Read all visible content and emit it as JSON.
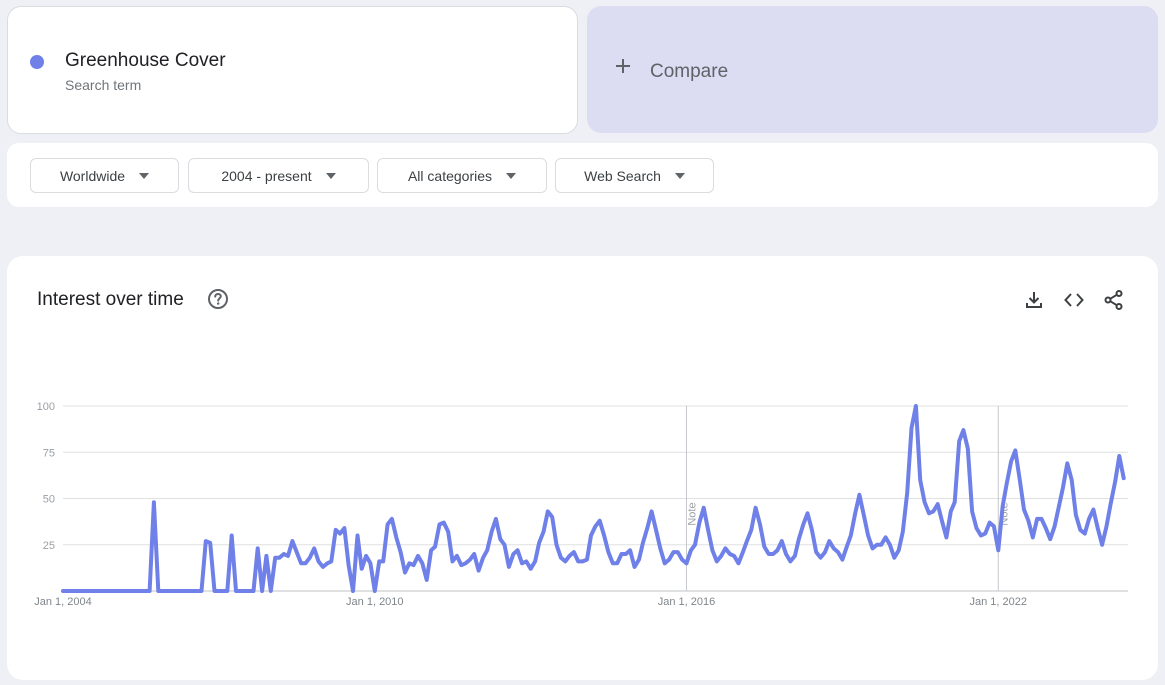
{
  "search_term": {
    "name": "Greenhouse Cover",
    "type": "Search term",
    "color": "#6f80e8"
  },
  "compare": {
    "label": "Compare",
    "icon": "plus-icon"
  },
  "filters": [
    {
      "label": "Worldwide"
    },
    {
      "label": "2004 - present"
    },
    {
      "label": "All categories"
    },
    {
      "label": "Web Search"
    }
  ],
  "panel": {
    "title": "Interest over time",
    "help_icon": "help-circle-icon",
    "tools": [
      "download-icon",
      "embed-code-icon",
      "share-icon"
    ]
  },
  "chart_data": {
    "type": "line",
    "title": "",
    "xlabel": "",
    "ylabel": "",
    "xlim": [
      "Jan 1, 2004",
      "Jun 2024"
    ],
    "ylim": [
      0,
      100
    ],
    "y_ticks": [
      100,
      75,
      50,
      25
    ],
    "x_tick_labels": [
      "Jan 1, 2004",
      "Jan 1, 2010",
      "Jan 1, 2016",
      "Jan 1, 2022"
    ],
    "grid": true,
    "legend": "none",
    "annotations": [
      {
        "label": "Note",
        "at": "Jan 1, 2016"
      },
      {
        "label": "Note",
        "at": "Jan 1, 2022"
      }
    ],
    "series": [
      {
        "color": "#6f80e8",
        "points": [
          [
            "2004-01",
            0
          ],
          [
            "2005-09",
            0
          ],
          [
            "2005-10",
            48
          ],
          [
            "2005-11",
            0
          ],
          [
            "2006-09",
            0
          ],
          [
            "2006-10",
            27
          ],
          [
            "2006-11",
            26
          ],
          [
            "2006-12",
            0
          ],
          [
            "2007-03",
            0
          ],
          [
            "2007-04",
            30
          ],
          [
            "2007-05",
            0
          ],
          [
            "2007-09",
            0
          ],
          [
            "2007-10",
            23
          ],
          [
            "2007-11",
            0
          ],
          [
            "2007-12",
            19
          ],
          [
            "2008-01",
            0
          ],
          [
            "2008-02",
            18
          ],
          [
            "2008-03",
            18
          ],
          [
            "2008-04",
            20
          ],
          [
            "2008-05",
            19
          ],
          [
            "2008-06",
            27
          ],
          [
            "2008-07",
            21
          ],
          [
            "2008-08",
            15
          ],
          [
            "2008-09",
            15
          ],
          [
            "2008-10",
            18
          ],
          [
            "2008-11",
            23
          ],
          [
            "2008-12",
            16
          ],
          [
            "2009-01",
            13
          ],
          [
            "2009-02",
            15
          ],
          [
            "2009-03",
            16
          ],
          [
            "2009-04",
            33
          ],
          [
            "2009-05",
            31
          ],
          [
            "2009-06",
            34
          ],
          [
            "2009-07",
            14
          ],
          [
            "2009-08",
            0
          ],
          [
            "2009-09",
            30
          ],
          [
            "2009-10",
            12
          ],
          [
            "2009-11",
            19
          ],
          [
            "2009-12",
            15
          ],
          [
            "2010-01",
            0
          ],
          [
            "2010-02",
            16
          ],
          [
            "2010-03",
            16
          ],
          [
            "2010-04",
            36
          ],
          [
            "2010-05",
            39
          ],
          [
            "2010-06",
            29
          ],
          [
            "2010-07",
            21
          ],
          [
            "2010-08",
            10
          ],
          [
            "2010-09",
            15
          ],
          [
            "2010-10",
            14
          ],
          [
            "2010-11",
            19
          ],
          [
            "2010-12",
            15
          ],
          [
            "2011-01",
            6
          ],
          [
            "2011-02",
            22
          ],
          [
            "2011-03",
            24
          ],
          [
            "2011-04",
            36
          ],
          [
            "2011-05",
            37
          ],
          [
            "2011-06",
            32
          ],
          [
            "2011-07",
            16
          ],
          [
            "2011-08",
            19
          ],
          [
            "2011-09",
            14
          ],
          [
            "2011-10",
            15
          ],
          [
            "2011-11",
            17
          ],
          [
            "2011-12",
            20
          ],
          [
            "2012-01",
            11
          ],
          [
            "2012-02",
            18
          ],
          [
            "2012-03",
            22
          ],
          [
            "2012-04",
            32
          ],
          [
            "2012-05",
            39
          ],
          [
            "2012-06",
            28
          ],
          [
            "2012-07",
            25
          ],
          [
            "2012-08",
            13
          ],
          [
            "2012-09",
            20
          ],
          [
            "2012-10",
            22
          ],
          [
            "2012-11",
            15
          ],
          [
            "2012-12",
            16
          ],
          [
            "2013-01",
            12
          ],
          [
            "2013-02",
            16
          ],
          [
            "2013-03",
            26
          ],
          [
            "2013-04",
            32
          ],
          [
            "2013-05",
            43
          ],
          [
            "2013-06",
            40
          ],
          [
            "2013-07",
            25
          ],
          [
            "2013-08",
            18
          ],
          [
            "2013-09",
            16
          ],
          [
            "2013-10",
            19
          ],
          [
            "2013-11",
            21
          ],
          [
            "2013-12",
            16
          ],
          [
            "2014-01",
            16
          ],
          [
            "2014-02",
            17
          ],
          [
            "2014-03",
            30
          ],
          [
            "2014-04",
            35
          ],
          [
            "2014-05",
            38
          ],
          [
            "2014-06",
            30
          ],
          [
            "2014-07",
            21
          ],
          [
            "2014-08",
            15
          ],
          [
            "2014-09",
            15
          ],
          [
            "2014-10",
            20
          ],
          [
            "2014-11",
            20
          ],
          [
            "2014-12",
            22
          ],
          [
            "2015-01",
            13
          ],
          [
            "2015-02",
            17
          ],
          [
            "2015-03",
            26
          ],
          [
            "2015-04",
            34
          ],
          [
            "2015-05",
            43
          ],
          [
            "2015-06",
            33
          ],
          [
            "2015-07",
            23
          ],
          [
            "2015-08",
            15
          ],
          [
            "2015-09",
            17
          ],
          [
            "2015-10",
            21
          ],
          [
            "2015-11",
            21
          ],
          [
            "2015-12",
            17
          ],
          [
            "2016-01",
            15
          ],
          [
            "2016-02",
            22
          ],
          [
            "2016-03",
            25
          ],
          [
            "2016-04",
            37
          ],
          [
            "2016-05",
            45
          ],
          [
            "2016-06",
            33
          ],
          [
            "2016-07",
            22
          ],
          [
            "2016-08",
            16
          ],
          [
            "2016-09",
            19
          ],
          [
            "2016-10",
            23
          ],
          [
            "2016-11",
            20
          ],
          [
            "2016-12",
            19
          ],
          [
            "2017-01",
            15
          ],
          [
            "2017-02",
            21
          ],
          [
            "2017-03",
            27
          ],
          [
            "2017-04",
            33
          ],
          [
            "2017-05",
            45
          ],
          [
            "2017-06",
            36
          ],
          [
            "2017-07",
            24
          ],
          [
            "2017-08",
            20
          ],
          [
            "2017-09",
            20
          ],
          [
            "2017-10",
            22
          ],
          [
            "2017-11",
            27
          ],
          [
            "2017-12",
            20
          ],
          [
            "2018-01",
            16
          ],
          [
            "2018-02",
            19
          ],
          [
            "2018-03",
            28
          ],
          [
            "2018-04",
            36
          ],
          [
            "2018-05",
            42
          ],
          [
            "2018-06",
            33
          ],
          [
            "2018-07",
            21
          ],
          [
            "2018-08",
            18
          ],
          [
            "2018-09",
            21
          ],
          [
            "2018-10",
            27
          ],
          [
            "2018-11",
            23
          ],
          [
            "2018-12",
            21
          ],
          [
            "2019-01",
            17
          ],
          [
            "2019-02",
            24
          ],
          [
            "2019-03",
            30
          ],
          [
            "2019-04",
            42
          ],
          [
            "2019-05",
            52
          ],
          [
            "2019-06",
            41
          ],
          [
            "2019-07",
            30
          ],
          [
            "2019-08",
            23
          ],
          [
            "2019-09",
            25
          ],
          [
            "2019-10",
            25
          ],
          [
            "2019-11",
            29
          ],
          [
            "2019-12",
            25
          ],
          [
            "2020-01",
            18
          ],
          [
            "2020-02",
            22
          ],
          [
            "2020-03",
            32
          ],
          [
            "2020-04",
            53
          ],
          [
            "2020-05",
            88
          ],
          [
            "2020-06",
            100
          ],
          [
            "2020-07",
            60
          ],
          [
            "2020-08",
            48
          ],
          [
            "2020-09",
            42
          ],
          [
            "2020-10",
            43
          ],
          [
            "2020-11",
            47
          ],
          [
            "2020-12",
            38
          ],
          [
            "2021-01",
            29
          ],
          [
            "2021-02",
            43
          ],
          [
            "2021-03",
            48
          ],
          [
            "2021-04",
            81
          ],
          [
            "2021-05",
            87
          ],
          [
            "2021-06",
            77
          ],
          [
            "2021-07",
            43
          ],
          [
            "2021-08",
            34
          ],
          [
            "2021-09",
            30
          ],
          [
            "2021-10",
            31
          ],
          [
            "2021-11",
            37
          ],
          [
            "2021-12",
            35
          ],
          [
            "2022-01",
            22
          ],
          [
            "2022-02",
            46
          ],
          [
            "2022-03",
            58
          ],
          [
            "2022-04",
            70
          ],
          [
            "2022-05",
            76
          ],
          [
            "2022-06",
            60
          ],
          [
            "2022-07",
            44
          ],
          [
            "2022-08",
            38
          ],
          [
            "2022-09",
            29
          ],
          [
            "2022-10",
            39
          ],
          [
            "2022-11",
            39
          ],
          [
            "2022-12",
            34
          ],
          [
            "2023-01",
            28
          ],
          [
            "2023-02",
            35
          ],
          [
            "2023-03",
            45
          ],
          [
            "2023-04",
            56
          ],
          [
            "2023-05",
            69
          ],
          [
            "2023-06",
            60
          ],
          [
            "2023-07",
            41
          ],
          [
            "2023-08",
            33
          ],
          [
            "2023-09",
            31
          ],
          [
            "2023-10",
            39
          ],
          [
            "2023-11",
            44
          ],
          [
            "2023-12",
            34
          ],
          [
            "2024-01",
            25
          ],
          [
            "2024-02",
            35
          ],
          [
            "2024-03",
            47
          ],
          [
            "2024-04",
            59
          ],
          [
            "2024-05",
            73
          ],
          [
            "2024-06",
            61
          ]
        ]
      }
    ]
  }
}
